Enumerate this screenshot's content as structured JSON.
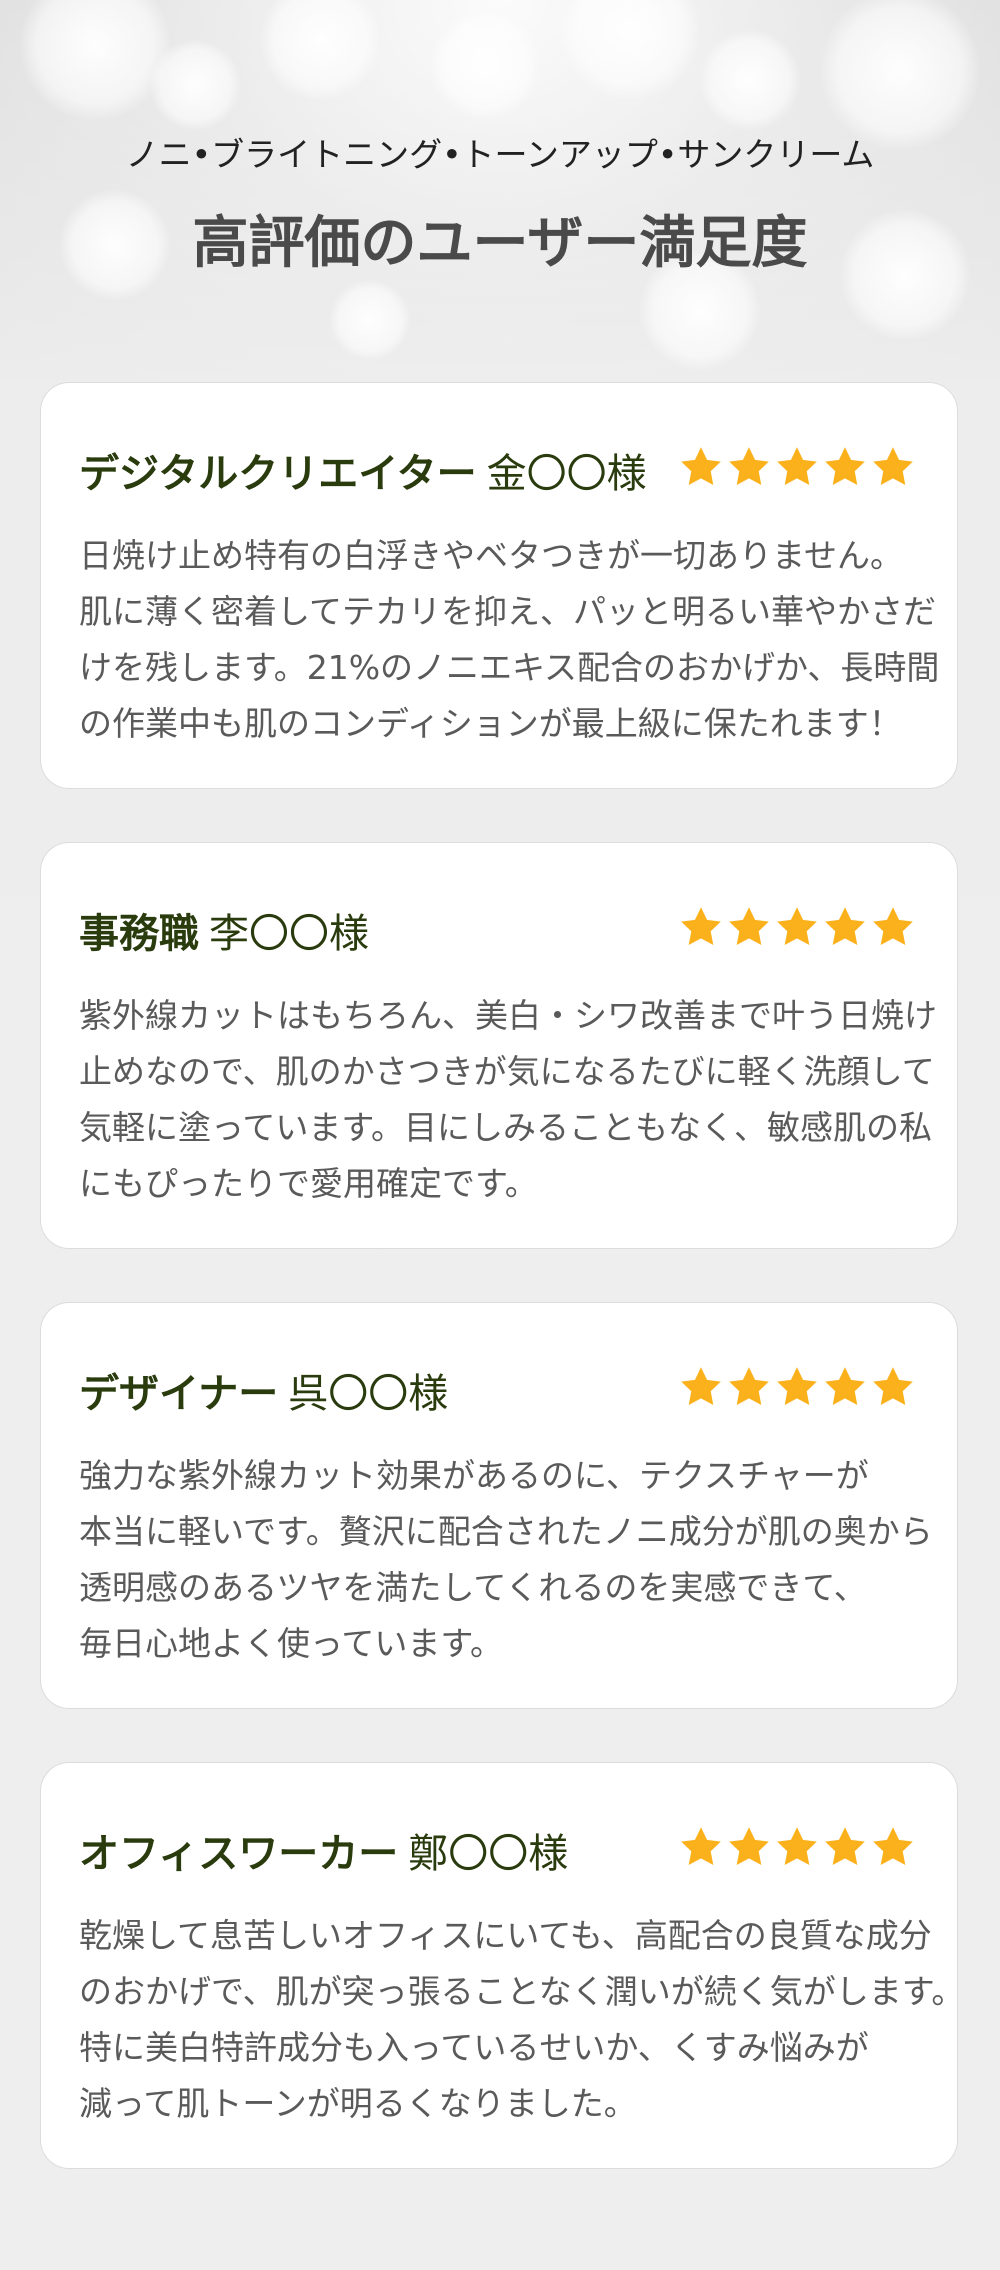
{
  "header": {
    "subtitle": "ノニ•ブライトニング•トーンアップ•サンクリーム",
    "title": "高評価のユーザー満足度"
  },
  "colors": {
    "star": "#fbb11b",
    "heading": "#2a3b0e",
    "body_text": "#5a5a5a"
  },
  "reviews": [
    {
      "role": "デジタルクリエイター",
      "name": "金〇〇様",
      "rating": 5,
      "lines": [
        "日焼け止め特有の白浮きやベタつきが一切ありません。",
        "肌に薄く密着してテカリを抑え、パッと明るい華やかさだ",
        "けを残します。21%のノニエキス配合のおかげか、長時間",
        "の作業中も肌のコンディションが最上級に保たれます！"
      ]
    },
    {
      "role": "事務職",
      "name": "李〇〇様",
      "rating": 5,
      "lines": [
        "紫外線カットはもちろん、美白・シワ改善まで叶う日焼け",
        "止めなので、肌のかさつきが気になるたびに軽く洗顔して",
        "気軽に塗っています。目にしみることもなく、敏感肌の私",
        "にもぴったりで愛用確定です。"
      ]
    },
    {
      "role": "デザイナー",
      "name": "呉〇〇様",
      "rating": 5,
      "lines": [
        "強力な紫外線カット効果があるのに、テクスチャーが",
        "本当に軽いです。贅沢に配合されたノニ成分が肌の奥から",
        "透明感のあるツヤを満たしてくれるのを実感できて、",
        "毎日心地よく使っています。"
      ]
    },
    {
      "role": "オフィスワーカー",
      "name": "鄭〇〇様",
      "rating": 5,
      "lines": [
        "乾燥して息苦しいオフィスにいても、高配合の良質な成分",
        "のおかげで、肌が突っ張ることなく潤いが続く気がします。",
        "特に美白特許成分も入っているせいか、くすみ悩みが",
        "減って肌トーンが明るくなりました。"
      ]
    }
  ]
}
